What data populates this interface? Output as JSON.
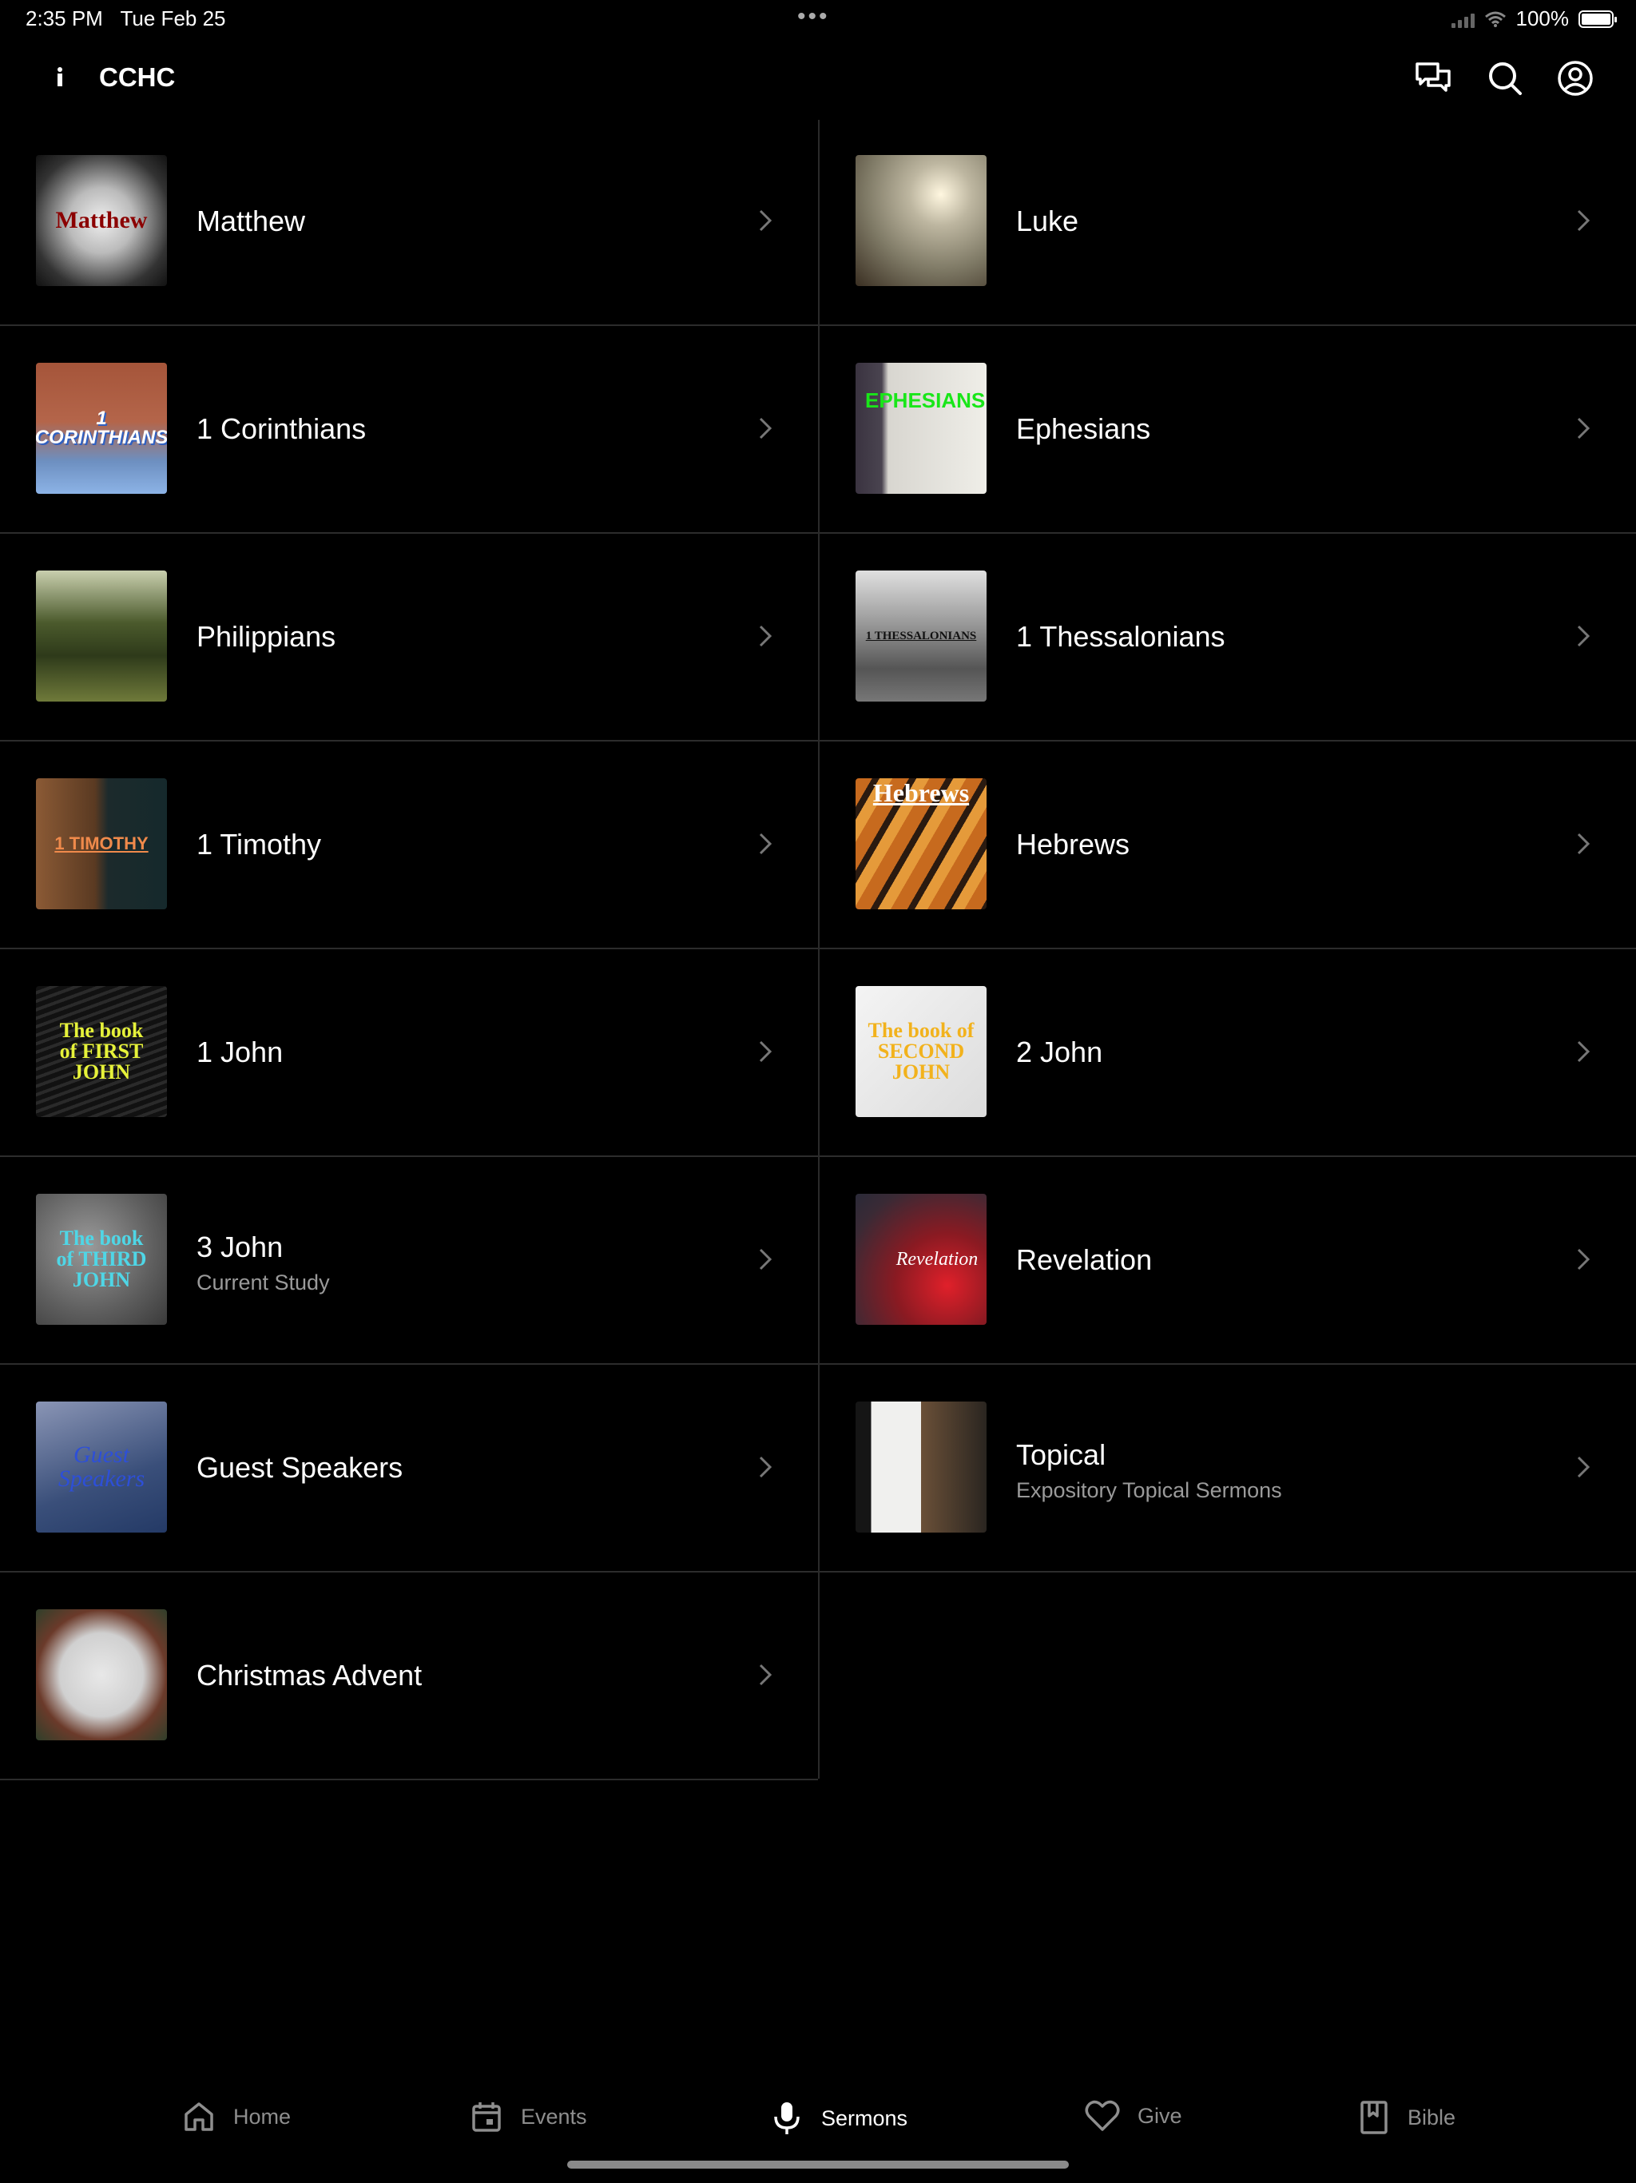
{
  "status": {
    "time": "2:35 PM",
    "date": "Tue Feb 25",
    "battery": "100%"
  },
  "app": {
    "title": "CCHC"
  },
  "series": {
    "left": [
      {
        "title": "Matthew",
        "subtitle": "",
        "thumb_text": "Matthew"
      },
      {
        "title": "1 Corinthians",
        "subtitle": "",
        "thumb_text": "1 CORINTHIANS"
      },
      {
        "title": "Philippians",
        "subtitle": "",
        "thumb_text": ""
      },
      {
        "title": "1 Timothy",
        "subtitle": "",
        "thumb_text": "1 TIMOTHY"
      },
      {
        "title": "1 John",
        "subtitle": "",
        "thumb_text": "The book of FIRST JOHN"
      },
      {
        "title": "3 John",
        "subtitle": "Current Study",
        "thumb_text": "The book of THIRD JOHN"
      },
      {
        "title": "Guest Speakers",
        "subtitle": "",
        "thumb_text": "Guest Speakers"
      },
      {
        "title": "Christmas Advent",
        "subtitle": "",
        "thumb_text": ""
      }
    ],
    "right": [
      {
        "title": "Luke",
        "subtitle": "",
        "thumb_text": ""
      },
      {
        "title": "Ephesians",
        "subtitle": "",
        "thumb_text": "EPHESIANS"
      },
      {
        "title": "1 Thessalonians",
        "subtitle": "",
        "thumb_text": "1 THESSALONIANS"
      },
      {
        "title": "Hebrews",
        "subtitle": "",
        "thumb_text": "Hebrews"
      },
      {
        "title": "2 John",
        "subtitle": "",
        "thumb_text": "The book of SECOND JOHN"
      },
      {
        "title": "Revelation",
        "subtitle": "",
        "thumb_text": "Revelation"
      },
      {
        "title": "Topical",
        "subtitle": "Expository Topical Sermons",
        "thumb_text": ""
      }
    ]
  },
  "tabs": [
    {
      "label": "Home",
      "icon": "home-icon",
      "active": false
    },
    {
      "label": "Events",
      "icon": "calendar-icon",
      "active": false
    },
    {
      "label": "Sermons",
      "icon": "microphone-icon",
      "active": true
    },
    {
      "label": "Give",
      "icon": "heart-icon",
      "active": false
    },
    {
      "label": "Bible",
      "icon": "bookmark-book-icon",
      "active": false
    }
  ],
  "colors": {
    "background": "#000000",
    "text": "#ffffff",
    "muted": "#9a9a9a",
    "divider": "#2c2c2c"
  }
}
